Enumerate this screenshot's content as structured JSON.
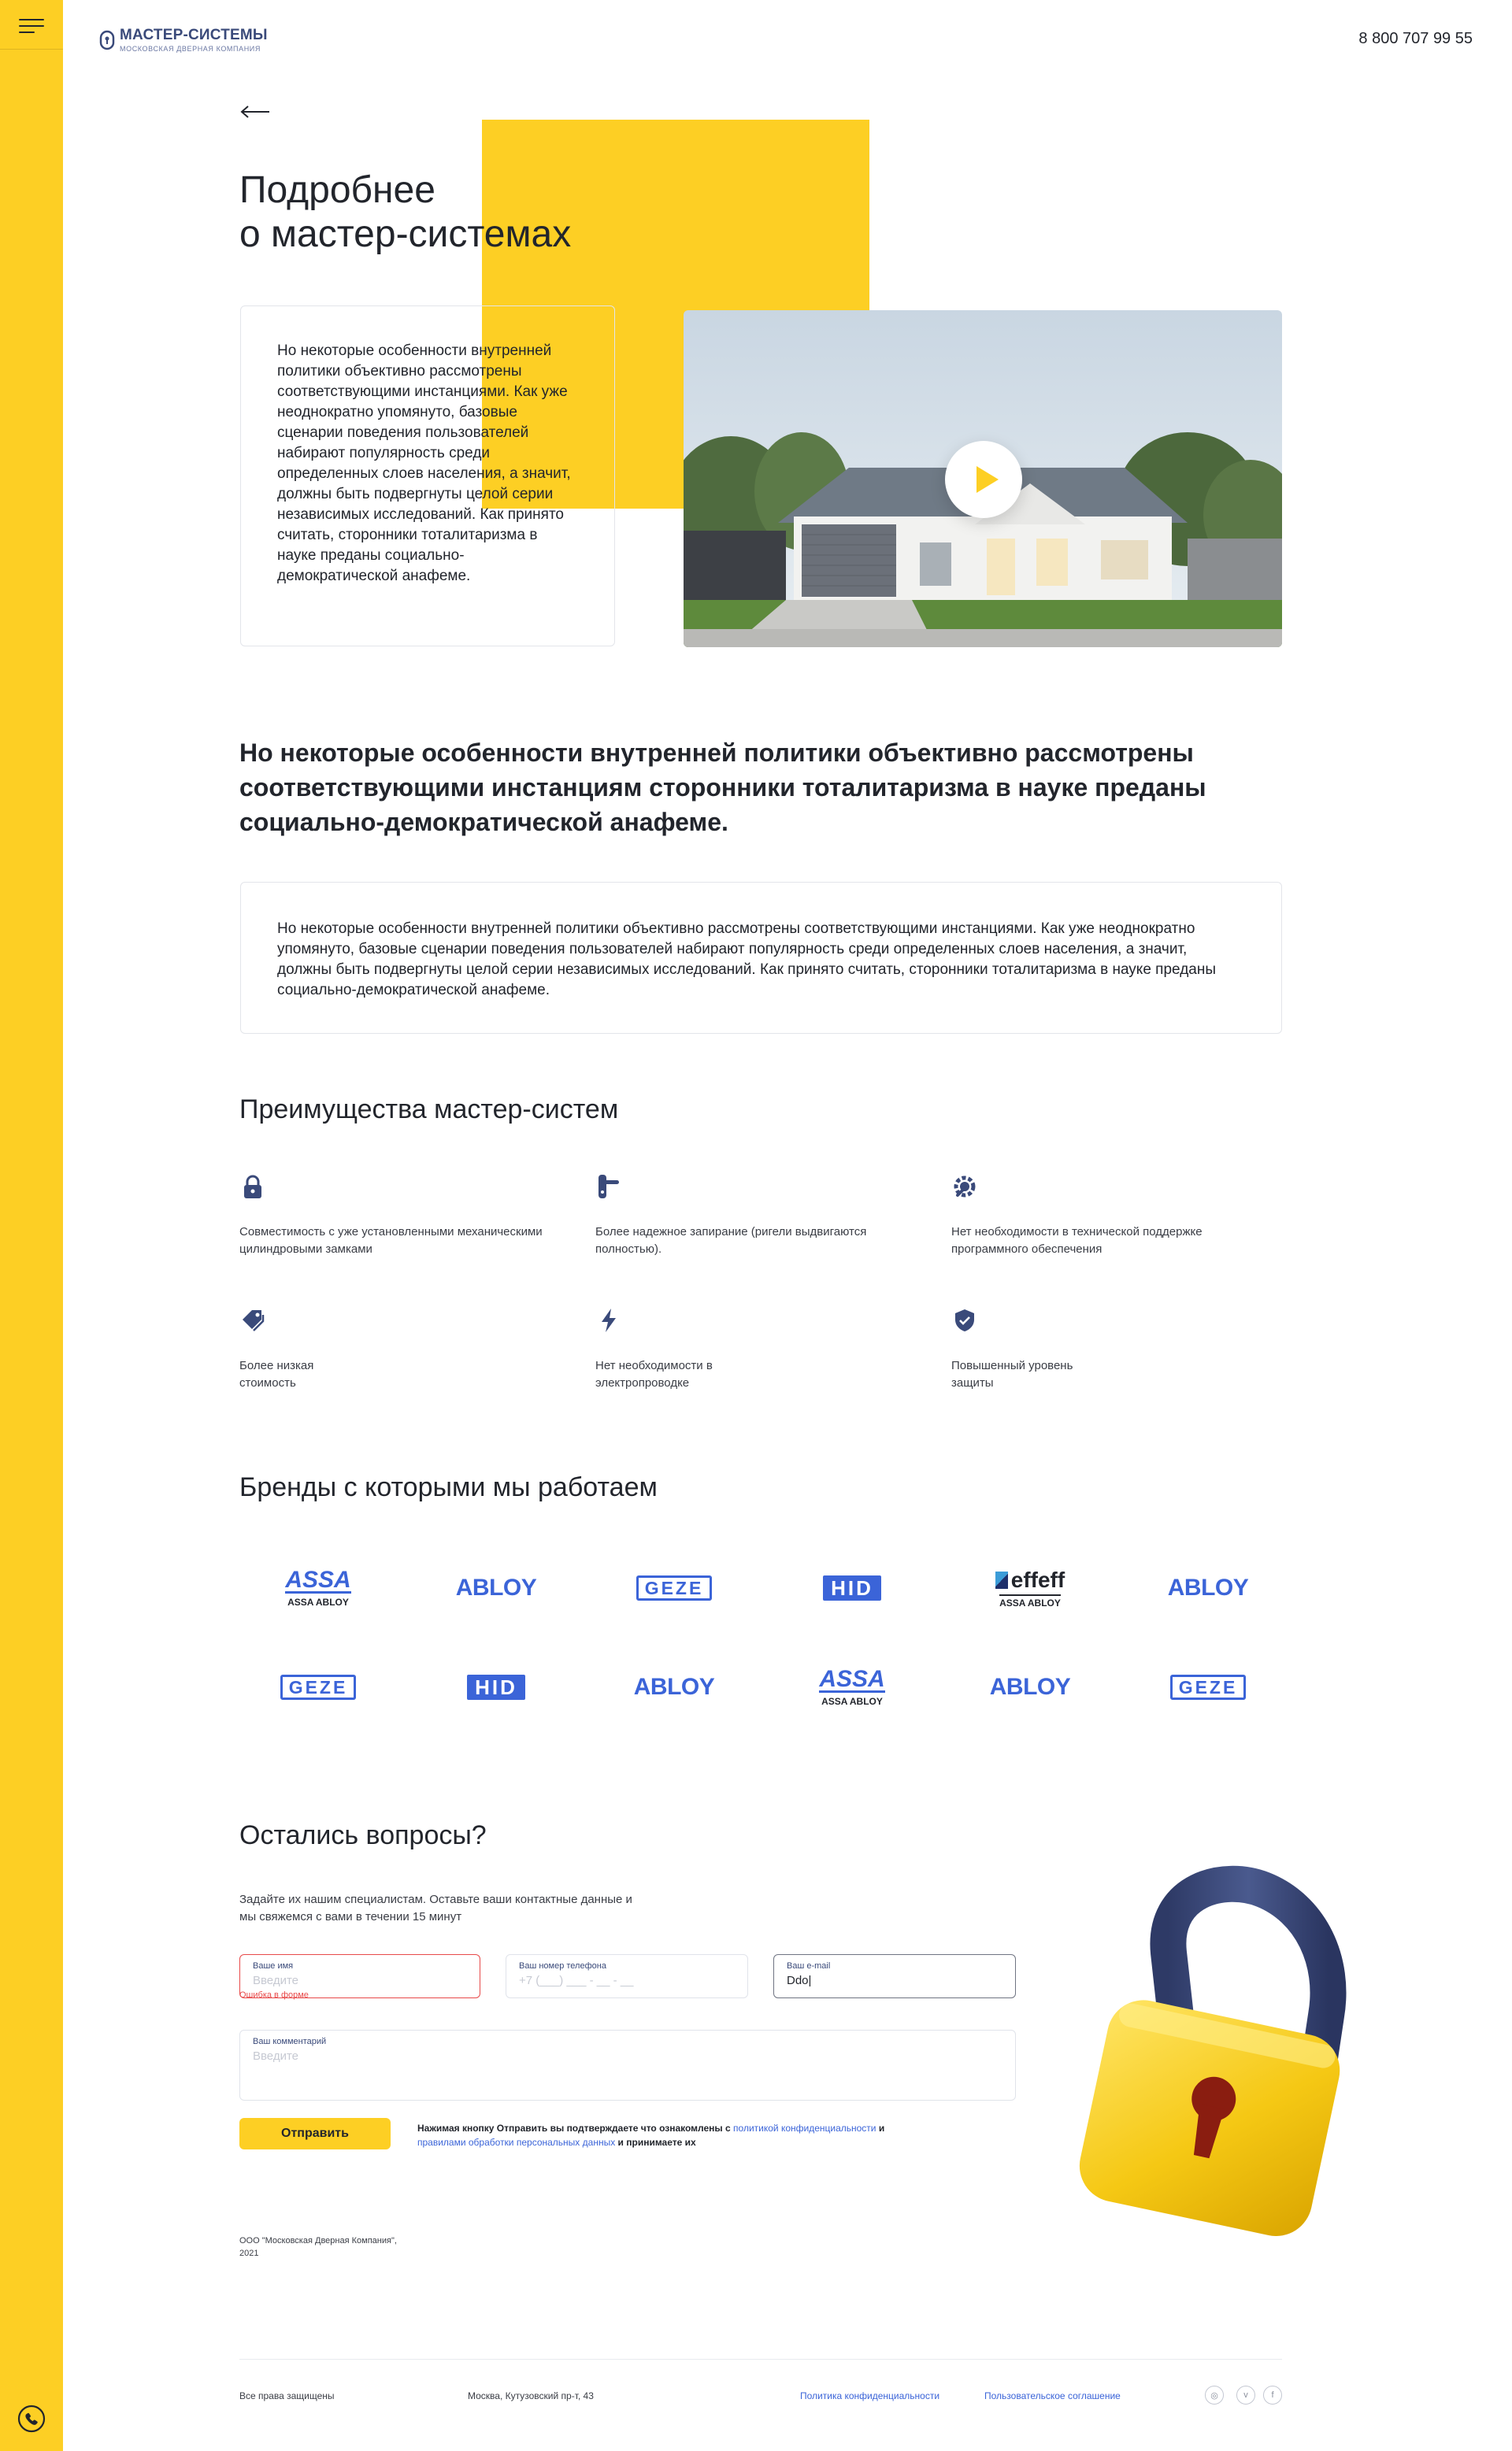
{
  "header": {
    "logo_title": "МАСТЕР-СИСТЕМЫ",
    "logo_subtitle": "МОСКОВСКАЯ ДВЕРНАЯ КОМПАНИЯ",
    "phone": "8 800 707 99 55"
  },
  "colors": {
    "accent": "#fdcf24",
    "brand": "#3b64d8",
    "text": "#22252c",
    "error": "#e84a4a"
  },
  "hero": {
    "title_line1": "Подробнее",
    "title_line2": "о мастер-системах",
    "card_text": "Но некоторые особенности внутренней политики объективно рассмотрены соответствующими инстанциями. Как уже неоднократно упомянуто, базовые сценарии поведения пользователей набирают популярность среди определенных слоев населения, а значит, должны быть подвергнуты целой серии независимых исследований. Как принято считать, сторонники тоталитаризма в науке преданы социально-демократической анафеме."
  },
  "lead": "Но некоторые особенности внутренней политики объективно рассмотрены соответствующими инстанциям сторонники тоталитаризма в науке преданы социально-демократической анафеме.",
  "wide_text": "Но некоторые особенности внутренней политики объективно рассмотрены соответствующими инстанциями. Как уже неоднократно упомянуто, базовые сценарии поведения пользователей набирают популярность среди определенных слоев населения, а значит, должны быть подвергнуты целой серии независимых исследований. Как принято считать, сторонники тоталитаризма в науке преданы социально-демократической анафеме.",
  "advantages": {
    "title": "Преимущества мастер-систем",
    "items": [
      {
        "icon": "lock-icon",
        "text": "Совместимость с уже установленными механическими цилиндровыми замками"
      },
      {
        "icon": "door-handle-icon",
        "text": "Более надежное запирание (ригели выдвигаются полностью)."
      },
      {
        "icon": "gear-wrench-icon",
        "text": "Нет необходимости в технической поддержке программного обеспечения"
      },
      {
        "icon": "tag-icon",
        "text": "Более низкая стоимость"
      },
      {
        "icon": "lightning-icon",
        "text": "Нет необходимости в электропроводке"
      },
      {
        "icon": "shield-check-icon",
        "text": "Повышенный уровень защиты"
      }
    ]
  },
  "brands": {
    "title": "Бренды с которыми мы работаем",
    "row1": [
      {
        "kind": "assa",
        "name": "ASSA",
        "sub": "ASSA ABLOY"
      },
      {
        "kind": "abloy",
        "name": "ABLOY"
      },
      {
        "kind": "geze",
        "name": "GEZE"
      },
      {
        "kind": "hid",
        "name": "HID"
      },
      {
        "kind": "effeff",
        "name": "effeff",
        "sub": "ASSA ABLOY"
      },
      {
        "kind": "abloy",
        "name": "ABLOY"
      }
    ],
    "row2": [
      {
        "kind": "geze",
        "name": "GEZE"
      },
      {
        "kind": "hid",
        "name": "HID"
      },
      {
        "kind": "abloy",
        "name": "ABLOY"
      },
      {
        "kind": "assa",
        "name": "ASSA",
        "sub": "ASSA ABLOY"
      },
      {
        "kind": "abloy",
        "name": "ABLOY"
      },
      {
        "kind": "geze",
        "name": "GEZE"
      }
    ]
  },
  "form": {
    "title": "Остались вопросы?",
    "subtitle": "Задайте их нашим специалистам. Оставьте ваши контактные данные и мы свяжемся с вами в течении 15 минут",
    "name_label": "Ваше имя",
    "name_placeholder": "Введите",
    "name_error": "Ошибка в форме",
    "phone_label": "Ваш номер телефона",
    "phone_placeholder": "+7 (___) ___ - __ - __",
    "email_label": "Ваш e-mail",
    "email_value": "Ddo|",
    "comment_label": "Ваш комментарий",
    "comment_placeholder": "Введите",
    "submit": "Отправить",
    "consent_1": "Нажимая кнопку Отправить вы подтверждаете что ознакомлены с ",
    "consent_link1": "политикой конфиденциальности",
    "consent_2": " и ",
    "consent_link2": "правилами обработки персональных данных",
    "consent_3": " и принимаете их"
  },
  "company": "ООО \"Московская Дверная Компания\", 2021",
  "footer": {
    "rights": "Все права защищены",
    "address": "Москва, Кутузовский пр-т, 43",
    "privacy": "Политика конфиденциальности",
    "agreement": "Пользовательское соглашение",
    "social": [
      "instagram-icon",
      "vk-icon",
      "facebook-icon"
    ]
  }
}
